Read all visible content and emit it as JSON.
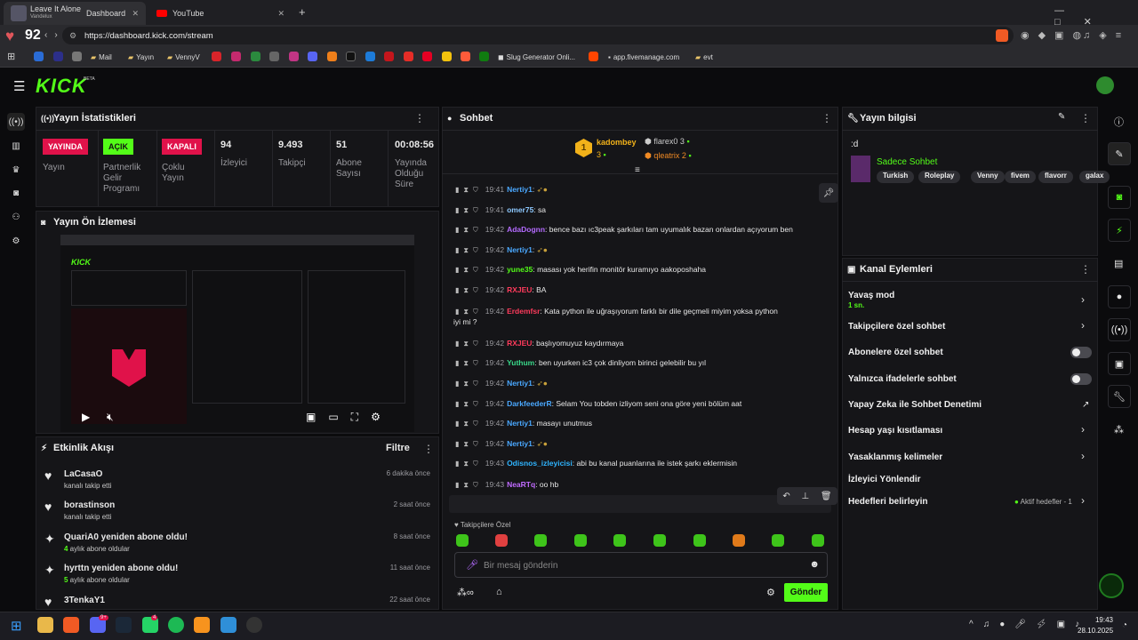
{
  "browser": {
    "tabs": [
      {
        "label": "Leave It Alone"
      },
      {
        "label": "Dashboard"
      },
      {
        "label": "YouTube"
      }
    ],
    "tab_sub": "Vandelux",
    "heart_temp": "92",
    "url": "https://dashboard.kick.com/stream",
    "bookmarks": [
      "Mail",
      "Yayın",
      "VennyV",
      "Slug Generator Onli...",
      "app.fivemanage.com",
      "evt"
    ]
  },
  "kick": {
    "logo": "KICK",
    "beta": "BETA"
  },
  "stats": {
    "title": "Yayın İstatistikleri",
    "items": [
      {
        "badge": "YAYINDA",
        "label": "Yayın"
      },
      {
        "badge": "AÇIK",
        "label": "Partnerlik Gelir Programı"
      },
      {
        "badge": "KAPALI",
        "label": "Çoklu Yayın"
      }
    ],
    "nums": [
      {
        "value": "94",
        "label": "İzleyici"
      },
      {
        "value": "9.493",
        "label": "Takipçi"
      },
      {
        "value": "51",
        "label": "Abone Sayısı"
      },
      {
        "value": "00:08:56",
        "label": "Yayında Olduğu Süre"
      }
    ]
  },
  "preview": {
    "title": "Yayın Ön İzlemesi"
  },
  "activity": {
    "title": "Etkinlik Akışı",
    "filter": "Filtre",
    "items": [
      {
        "name": "LaCasaO",
        "sub": "kanalı takip etti",
        "time": "6 dakika önce",
        "icon": "heart-icon"
      },
      {
        "name": "borastinson",
        "sub": "kanalı takip etti",
        "time": "2 saat önce",
        "icon": "heart-icon"
      },
      {
        "name": "QuariA0 yeniden abone oldu!",
        "sub_num": "4",
        "sub": " aylık abone oldular",
        "time": "8 saat önce",
        "icon": "star-icon"
      },
      {
        "name": "hyrttn yeniden abone oldu!",
        "sub_num": "5",
        "sub": " aylık abone oldular",
        "time": "11 saat önce",
        "icon": "star-icon"
      },
      {
        "name": "3TenkaY1",
        "sub": "",
        "time": "22 saat önce",
        "icon": "heart-icon"
      }
    ]
  },
  "chat": {
    "title": "Sohbet",
    "leaders": [
      {
        "rank": "1",
        "name": "kadombey",
        "count": "3"
      },
      {
        "name": "flarex0",
        "count": "3"
      },
      {
        "name": "qleatrix",
        "count": "2"
      }
    ],
    "messages": [
      {
        "time": "19:41",
        "user": "Nertiy1",
        "color": "#4aa8ff",
        "text": ""
      },
      {
        "time": "19:41",
        "user": "omer75",
        "color": "#8ec9ff",
        "text": "sa"
      },
      {
        "time": "19:42",
        "user": "AdaDognn",
        "color": "#b46bff",
        "text": "bence bazı ıc3peak şarkıları tam uyumalık bazan onlardan açıyorum ben"
      },
      {
        "time": "19:42",
        "user": "Nertiy1",
        "color": "#4aa8ff",
        "text": ""
      },
      {
        "time": "19:42",
        "user": "yune35",
        "color": "#53fc18",
        "text": "masası yok herifin monitör kuramıyo aakoposhaha"
      },
      {
        "time": "19:42",
        "user": "RXJEU",
        "color": "#ff3b5c",
        "text": "BA"
      },
      {
        "time": "19:42",
        "user": "Erdemfsr",
        "color": "#ff3b5c",
        "text": "Kata python ile uğraşıyorum farklı bir dile geçmeli miyim yoksa python"
      },
      {
        "time": "",
        "user": "",
        "color": "#e8e8e8",
        "text": "iyi mi ?"
      },
      {
        "time": "19:42",
        "user": "RXJEU",
        "color": "#ff3b5c",
        "text": "başlıyomuyuz kaydırmaya"
      },
      {
        "time": "19:42",
        "user": "Yuthum",
        "color": "#39d98a",
        "text": "ben uyurken ic3 çok dinliyom birinci gelebilir bu yıl"
      },
      {
        "time": "19:42",
        "user": "Nertiy1",
        "color": "#4aa8ff",
        "text": ""
      },
      {
        "time": "19:42",
        "user": "DarkfeederR",
        "color": "#4aa8ff",
        "text": "Selam You tobden izliyom seni ona göre yeni bölüm aat"
      },
      {
        "time": "19:42",
        "user": "Nertiy1",
        "color": "#4aa8ff",
        "text": "masayı unutmus"
      },
      {
        "time": "19:42",
        "user": "Nertiy1",
        "color": "#4aa8ff",
        "text": ""
      },
      {
        "time": "19:43",
        "user": "Odisnos_izleyicisi",
        "color": "#2fb4ff",
        "text": "abi bu kanal puanlarına ile istek şarkı eklermisin"
      },
      {
        "time": "19:43",
        "user": "NeaRTq",
        "color": "#c06bff",
        "text": "oo hb"
      },
      {
        "time": "19:43",
        "user": "yune35",
        "color": "#53fc18",
        "text": "?"
      }
    ],
    "followers_only": "Takipçilere Özel",
    "placeholder": "Bir mesaj gönderin",
    "send": "Gönder"
  },
  "streaminfo": {
    "title": "Yayın bilgisi",
    "text": ":d",
    "category": "Sadece Sohbet",
    "tags": [
      "Turkish",
      "Roleplay",
      "Venny",
      "fivem",
      "flavorr",
      "galax"
    ]
  },
  "actions": {
    "title": "Kanal Eylemleri",
    "items": [
      {
        "label": "Yavaş mod",
        "sub": "1 sn."
      },
      {
        "label": "Takipçilere özel sohbet"
      },
      {
        "label": "Abonelere özel sohbet"
      },
      {
        "label": "Yalnızca ifadelerle sohbet"
      },
      {
        "label": "Yapay Zeka ile Sohbet Denetimi"
      },
      {
        "label": "Hesap yaşı kısıtlaması"
      },
      {
        "label": "Yasaklanmış kelimeler"
      },
      {
        "label": "İzleyici Yönlendir"
      },
      {
        "label": "Hedefleri belirleyin",
        "extra": "Aktif hedefler - 1"
      }
    ]
  },
  "taskbar": {
    "time": "19:43",
    "date": "28.10.2025",
    "badge1": "9+",
    "badge2": "4"
  }
}
